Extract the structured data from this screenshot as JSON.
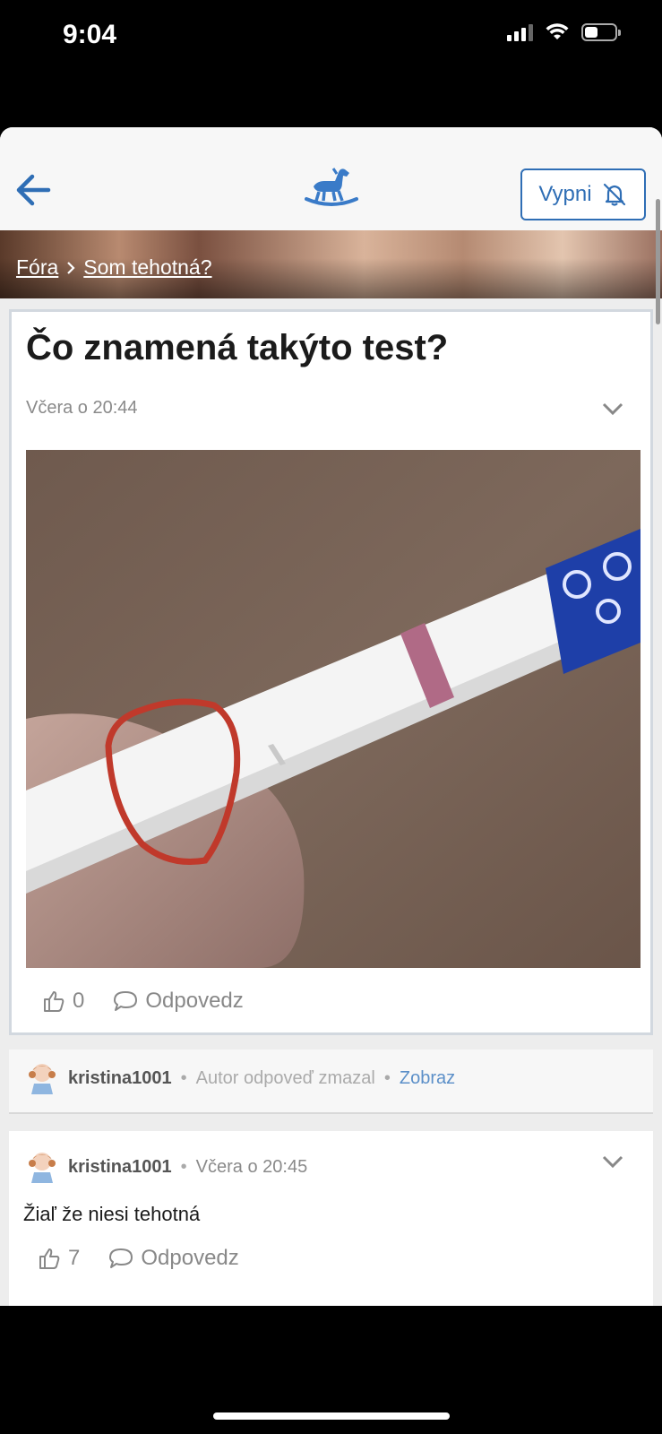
{
  "status": {
    "time": "9:04"
  },
  "header": {
    "vypni_label": "Vypni"
  },
  "breadcrumb": {
    "items": [
      "Fóra",
      "Som tehotná?"
    ]
  },
  "post": {
    "title": "Čo znamená takýto test?",
    "time": "Včera o 20:44",
    "likes": "0",
    "reply_label": "Odpovedz"
  },
  "comments": [
    {
      "author": "kristina1001",
      "note": "Autor odpoveď zmazal",
      "show_label": "Zobraz"
    },
    {
      "author": "kristina1001",
      "time": "Včera o 20:45",
      "text": "Žiaľ že niesi tehotná",
      "likes": "7",
      "reply_label": "Odpovedz"
    }
  ],
  "colors": {
    "accent": "#2f6eb5",
    "link": "#5b8fc8",
    "text": "#1b1b1b",
    "muted": "#8a8a8a"
  }
}
